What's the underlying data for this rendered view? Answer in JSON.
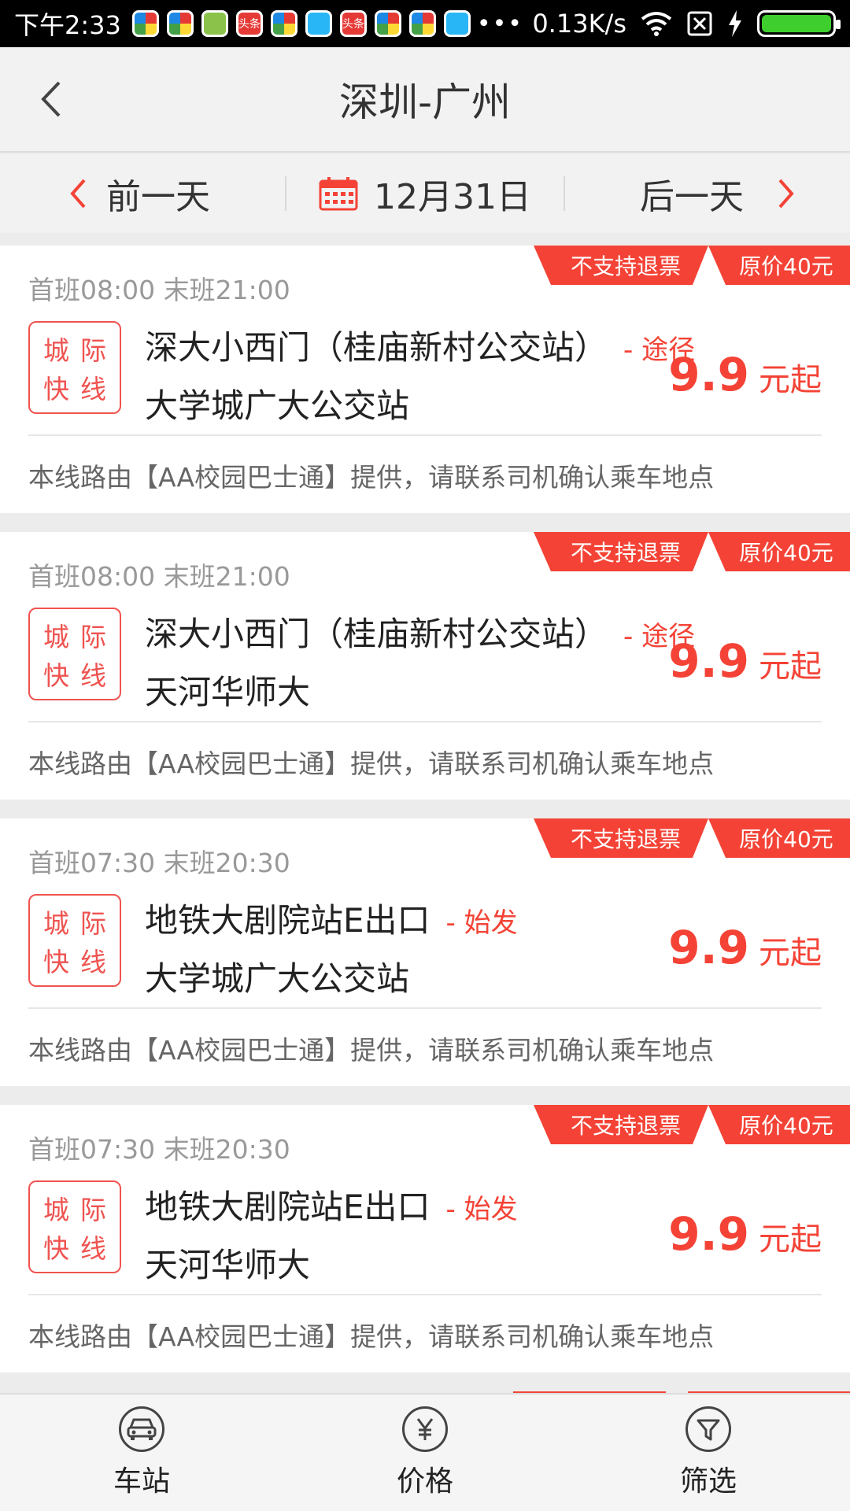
{
  "status_bar": {
    "time": "下午2:33",
    "more": "•••",
    "speed": "0.13K/s",
    "notif_label": "头条"
  },
  "header": {
    "title": "深圳-广州"
  },
  "date_bar": {
    "prev_label": "前一天",
    "date": "12月31日",
    "next_label": "后一天"
  },
  "theme": {
    "accent": "#f44336",
    "background": "#ececec"
  },
  "routes": [
    {
      "times": "首班08:00  末班21:00",
      "badge": [
        "城",
        "际",
        "快",
        "线"
      ],
      "from": "深大小西门（桂庙新村公交站）",
      "from_tag": "- 途径",
      "to": "大学城广大公交站",
      "price": "9.9",
      "price_unit": "元起",
      "refund_label": "不支持退票",
      "orig_price": "原价40元",
      "note": "本线路由【AA校园巴士通】提供，请联系司机确认乘车地点"
    },
    {
      "times": "首班08:00  末班21:00",
      "badge": [
        "城",
        "际",
        "快",
        "线"
      ],
      "from": "深大小西门（桂庙新村公交站）",
      "from_tag": "- 途径",
      "to": "天河华师大",
      "price": "9.9",
      "price_unit": "元起",
      "refund_label": "不支持退票",
      "orig_price": "原价40元",
      "note": "本线路由【AA校园巴士通】提供，请联系司机确认乘车地点"
    },
    {
      "times": "首班07:30  末班20:30",
      "badge": [
        "城",
        "际",
        "快",
        "线"
      ],
      "from": "地铁大剧院站E出口",
      "from_tag": "- 始发",
      "to": "大学城广大公交站",
      "price": "9.9",
      "price_unit": "元起",
      "refund_label": "不支持退票",
      "orig_price": "原价40元",
      "note": "本线路由【AA校园巴士通】提供，请联系司机确认乘车地点"
    },
    {
      "times": "首班07:30  末班20:30",
      "badge": [
        "城",
        "际",
        "快",
        "线"
      ],
      "from": "地铁大剧院站E出口",
      "from_tag": "- 始发",
      "to": "天河华师大",
      "price": "9.9",
      "price_unit": "元起",
      "refund_label": "不支持退票",
      "orig_price": "原价40元",
      "note": "本线路由【AA校园巴士通】提供，请联系司机确认乘车地点"
    }
  ],
  "tab_bar": {
    "tabs": [
      {
        "label": "车站",
        "icon": "car-icon"
      },
      {
        "label": "价格",
        "icon": "yuan-icon"
      },
      {
        "label": "筛选",
        "icon": "filter-icon"
      }
    ]
  }
}
